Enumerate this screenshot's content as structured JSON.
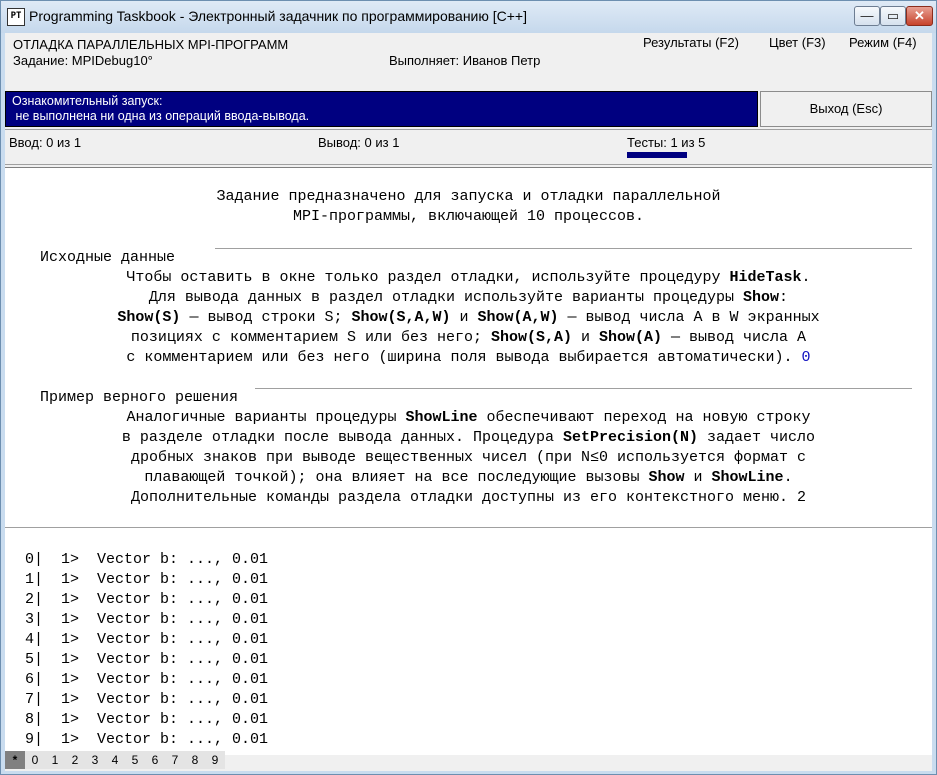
{
  "window": {
    "title": "Programming Taskbook - Электронный задачник по программированию [C++]",
    "icon_label": "PT",
    "minimize_glyph": "—",
    "maximize_glyph": "▭",
    "close_glyph": "✕"
  },
  "header": {
    "section_title": "ОТЛАДКА ПАРАЛЛЕЛЬНЫХ MPI-ПРОГРАММ",
    "task_label": "Задание: MPIDebug10°",
    "performer_label": "Выполняет: Иванов Петр",
    "menu": {
      "results": "Результаты (F2)",
      "color": "Цвет (F3)",
      "mode": "Режим (F4)"
    }
  },
  "status": {
    "line1": "Ознакомительный запуск:",
    "line2": " не выполнена ни одна из операций ввода-вывода.",
    "exit_button": "Выход (Esc)"
  },
  "counters": {
    "input": "Ввод: 0 из 1",
    "output": "Вывод: 0 из 1",
    "tests": "Тесты: 1 из 5"
  },
  "task": {
    "intro_line1": "Задание предназначено для запуска и отладки параллельной",
    "intro_line2": "MPI-программы, включающей 10 процессов.",
    "section1_title": "Исходные данные",
    "s1": {
      "l1a": "Чтобы оставить в окне только раздел отладки, используйте процедуру ",
      "l1b": "HideTask",
      "l1c": ".",
      "l2a": "Для вывода данных в раздел отладки используйте варианты процедуры ",
      "l2b": "Show",
      "l2c": ":",
      "l3a": "Show(S)",
      "l3b": " — вывод строки S; ",
      "l3c": "Show(S,A,W)",
      "l3d": " и ",
      "l3e": "Show(A,W)",
      "l3f": " — вывод числа A в W экранных",
      "l4a": "позициях с комментарием S или без него; ",
      "l4b": "Show(S,A)",
      "l4c": " и ",
      "l4d": "Show(A)",
      "l4e": " — вывод числа A",
      "l5a": "с комментарием или без него (ширина поля вывода выбирается автоматически). ",
      "l5b": "0"
    },
    "section2_title": "Пример верного решения",
    "s2": {
      "l1a": "Аналогичные варианты процедуры ",
      "l1b": "ShowLine",
      "l1c": " обеспечивают переход на новую строку",
      "l2a": "в разделе отладки после вывода данных. Процедура ",
      "l2b": "SetPrecision(N)",
      "l2c": " задает число",
      "l3": "дробных знаков при выводе вещественных чисел (при N≤0 используется формат с",
      "l4a": "плавающей точкой); она влияет на все последующие вызовы ",
      "l4b": "Show",
      "l4c": " и ",
      "l4d": "ShowLine",
      "l4e": ".",
      "l5a": "Дополнительные команды раздела отладки доступны из его контекстного меню. ",
      "l5b": "2"
    }
  },
  "debug_lines": [
    "0|  1>  Vector b: ..., 0.01",
    "1|  1>  Vector b: ..., 0.01",
    "2|  1>  Vector b: ..., 0.01",
    "3|  1>  Vector b: ..., 0.01",
    "4|  1>  Vector b: ..., 0.01",
    "5|  1>  Vector b: ..., 0.01",
    "6|  1>  Vector b: ..., 0.01",
    "7|  1>  Vector b: ..., 0.01",
    "8|  1>  Vector b: ..., 0.01",
    "9|  1>  Vector b: ..., 0.01"
  ],
  "process_tabs": [
    "*",
    "0",
    "1",
    "2",
    "3",
    "4",
    "5",
    "6",
    "7",
    "8",
    "9"
  ]
}
